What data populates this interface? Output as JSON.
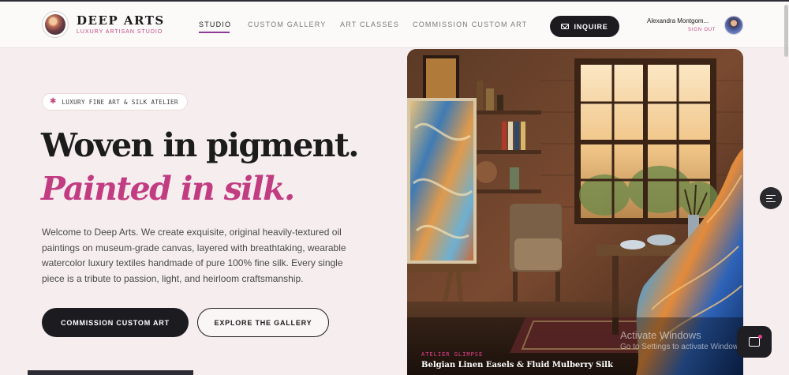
{
  "header": {
    "brand": "DEEP ARTS",
    "brand_sub": "LUXURY ARTISAN STUDIO",
    "nav": [
      "STUDIO",
      "CUSTOM GALLERY",
      "ART CLASSES",
      "COMMISSION CUSTOM ART"
    ],
    "active_nav": "STUDIO",
    "inquire_label": "INQUIRE",
    "user_name": "Alexandra Montgom...",
    "sign_out": "SIGN OUT"
  },
  "hero": {
    "pill": "LUXURY FINE ART & SILK ATELIER",
    "headline_1": "Woven in pigment.",
    "headline_2": "Painted in silk.",
    "description": "Welcome to Deep Arts. We create exquisite, original heavily-textured oil paintings on museum-grade canvas, layered with breathtaking, wearable watercolor luxury textiles handmade of pure 100% fine silk. Every single piece is a tribute to passion, light, and heirloom craftsmanship.",
    "primary_button": "COMMISSION CUSTOM ART",
    "secondary_button": "EXPLORE THE GALLERY"
  },
  "feature_image": {
    "caption_label": "ATELIER GLIMPSE",
    "caption_title": "Belgian Linen Easels & Fluid Mulberry Silk"
  },
  "os_watermark": {
    "line1": "Activate Windows",
    "line2": "Go to Settings to activate Windows."
  },
  "icons": {
    "logo": "artisan-logo-icon",
    "inquire": "mail-icon",
    "pill": "sparkle-icon",
    "float": "filter-list-icon",
    "chat": "chat-icon"
  },
  "colors": {
    "accent": "#c23c82",
    "dark": "#1c1b1f",
    "background": "#f6eeee",
    "nav_active_underline": "#8b3a9a"
  }
}
